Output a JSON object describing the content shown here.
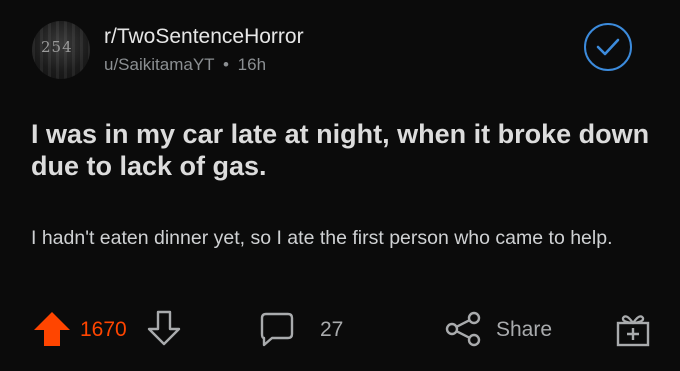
{
  "post": {
    "subreddit": "r/TwoSentenceHorror",
    "author": "u/SaikitamaYT",
    "separator": "•",
    "age": "16h",
    "avatar_text": "254",
    "title": "I was in my car late at night, when it broke down due to lack of gas.",
    "body": "I hadn't eaten dinner yet, so I ate the first person who came to help."
  },
  "actions": {
    "score": "1670",
    "comments": "27",
    "share_label": "Share"
  },
  "icons": {
    "avatar": "subreddit-avatar",
    "check": "check-circle-icon",
    "upvote": "upvote-arrow-icon",
    "downvote": "downvote-arrow-icon",
    "comment": "comment-bubble-icon",
    "share": "share-icon",
    "award": "award-gift-icon"
  },
  "colors": {
    "background": "#0b0b0b",
    "upvote_active": "#ff4500",
    "check_accent": "#3c8bdc",
    "muted_text": "#a9abad"
  }
}
